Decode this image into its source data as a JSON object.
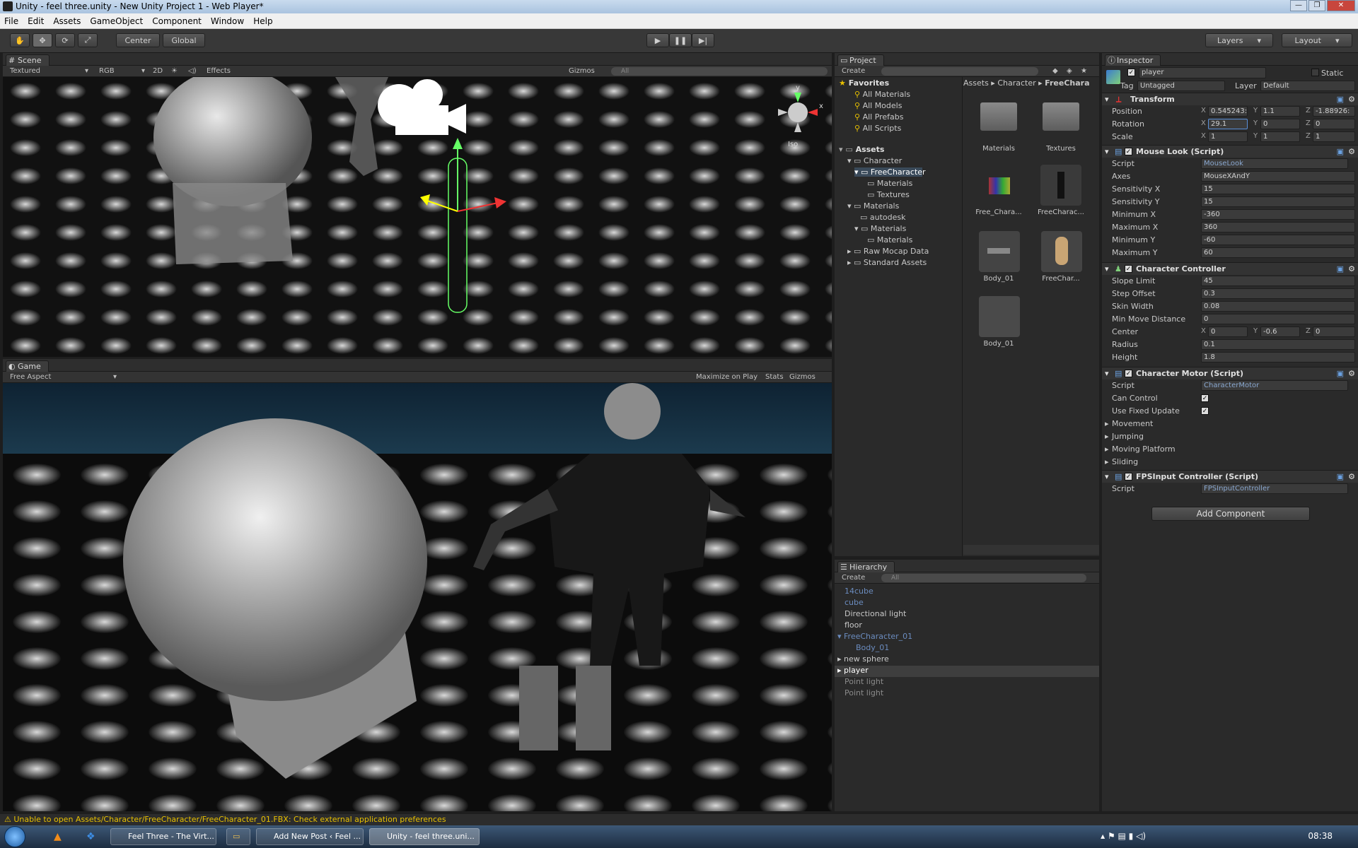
{
  "window": {
    "title": "Unity - feel three.unity - New Unity Project 1 - Web Player*"
  },
  "menu": [
    "File",
    "Edit",
    "Assets",
    "GameObject",
    "Component",
    "Window",
    "Help"
  ],
  "toolbar": {
    "center_label": "Center",
    "global_label": "Global",
    "layers_label": "Layers",
    "layout_label": "Layout"
  },
  "scene": {
    "tab": "Scene",
    "shading": "Textured",
    "render_mode": "RGB",
    "mode_2d": "2D",
    "effects": "Effects",
    "gizmos": "Gizmos",
    "search_placeholder": "All",
    "iso": "Iso",
    "gizmo_y": "y",
    "gizmo_x": "x"
  },
  "game": {
    "tab": "Game",
    "aspect": "Free Aspect",
    "maximize": "Maximize on Play",
    "stats": "Stats",
    "gizmos": "Gizmos"
  },
  "project": {
    "tab": "Project",
    "create": "Create",
    "breadcrumb": [
      "Assets",
      "Character",
      "FreeChara"
    ],
    "favorites_label": "Favorites",
    "favorites": [
      "All Materials",
      "All Models",
      "All Prefabs",
      "All Scripts"
    ],
    "assets_label": "Assets",
    "tree": [
      {
        "label": "Character",
        "depth": 1
      },
      {
        "label": "FreeCharacter",
        "depth": 2
      },
      {
        "label": "Materials",
        "depth": 3
      },
      {
        "label": "Textures",
        "depth": 3
      },
      {
        "label": "Materials",
        "depth": 1
      },
      {
        "label": "autodesk",
        "depth": 2
      },
      {
        "label": "Materials",
        "depth": 2
      },
      {
        "label": "Materials",
        "depth": 3
      },
      {
        "label": "Raw Mocap Data",
        "depth": 1
      },
      {
        "label": "Standard Assets",
        "depth": 1
      }
    ],
    "grid": [
      "Materials",
      "Textures",
      "Free_Chara...",
      "FreeCharac...",
      "Body_01",
      "FreeChar...",
      "Body_01"
    ]
  },
  "hierarchy": {
    "tab": "Hierarchy",
    "create": "Create",
    "search_placeholder": "All",
    "items": [
      {
        "label": "14cube",
        "style": "prefab"
      },
      {
        "label": "cube",
        "style": "prefab"
      },
      {
        "label": "Directional light",
        "style": "normal"
      },
      {
        "label": "floor",
        "style": "normal"
      },
      {
        "label": "FreeCharacter_01",
        "style": "prefab"
      },
      {
        "label": "Body_01",
        "style": "prefab"
      },
      {
        "label": "new sphere",
        "style": "normal"
      },
      {
        "label": "player",
        "style": "selected"
      },
      {
        "label": "Point light",
        "style": "dim"
      },
      {
        "label": "Point light",
        "style": "dim"
      }
    ]
  },
  "inspector": {
    "tab": "Inspector",
    "object_name": "player",
    "static_label": "Static",
    "tag_label": "Tag",
    "tag_value": "Untagged",
    "layer_label": "Layer",
    "layer_value": "Default",
    "transform": {
      "title": "Transform",
      "position_label": "Position",
      "position": [
        "0.545243:",
        "1.1",
        "-1.88926:"
      ],
      "rotation_label": "Rotation",
      "rotation": [
        "29.1",
        "0",
        "0"
      ],
      "scale_label": "Scale",
      "scale": [
        "1",
        "1",
        "1"
      ]
    },
    "mouse_look": {
      "title": "Mouse Look (Script)",
      "fields": [
        {
          "label": "Script",
          "value": "MouseLook"
        },
        {
          "label": "Axes",
          "value": "MouseXAndY"
        },
        {
          "label": "Sensitivity X",
          "value": "15"
        },
        {
          "label": "Sensitivity Y",
          "value": "15"
        },
        {
          "label": "Minimum X",
          "value": "-360"
        },
        {
          "label": "Maximum X",
          "value": "360"
        },
        {
          "label": "Minimum Y",
          "value": "-60"
        },
        {
          "label": "Maximum Y",
          "value": "60"
        }
      ]
    },
    "char_controller": {
      "title": "Character Controller",
      "fields": [
        {
          "label": "Slope Limit",
          "value": "45"
        },
        {
          "label": "Step Offset",
          "value": "0.3"
        },
        {
          "label": "Skin Width",
          "value": "0.08"
        },
        {
          "label": "Min Move Distance",
          "value": "0"
        }
      ],
      "center_label": "Center",
      "center": [
        "0",
        "-0.6",
        "0"
      ],
      "radius_label": "Radius",
      "radius": "0.1",
      "height_label": "Height",
      "height": "1.8"
    },
    "char_motor": {
      "title": "Character Motor (Script)",
      "script_label": "Script",
      "script": "CharacterMotor",
      "can_control": "Can Control",
      "fixed_update": "Use Fixed Update",
      "sections": [
        "Movement",
        "Jumping",
        "Moving Platform",
        "Sliding"
      ]
    },
    "fps_input": {
      "title": "FPSInput Controller (Script)",
      "script_label": "Script",
      "script": "FPSInputController"
    },
    "add_component": "Add Component",
    "axis_x": "X",
    "axis_y": "Y",
    "axis_z": "Z"
  },
  "status": {
    "message": "Unable to open Assets/Character/FreeCharacter/FreeCharacter_01.FBX: Check external application preferences"
  },
  "taskbar": {
    "tasks": [
      "Feel Three - The Virt...",
      "",
      "Add New Post ‹ Feel ...",
      "Unity - feel three.uni..."
    ],
    "clock": "08:38"
  }
}
